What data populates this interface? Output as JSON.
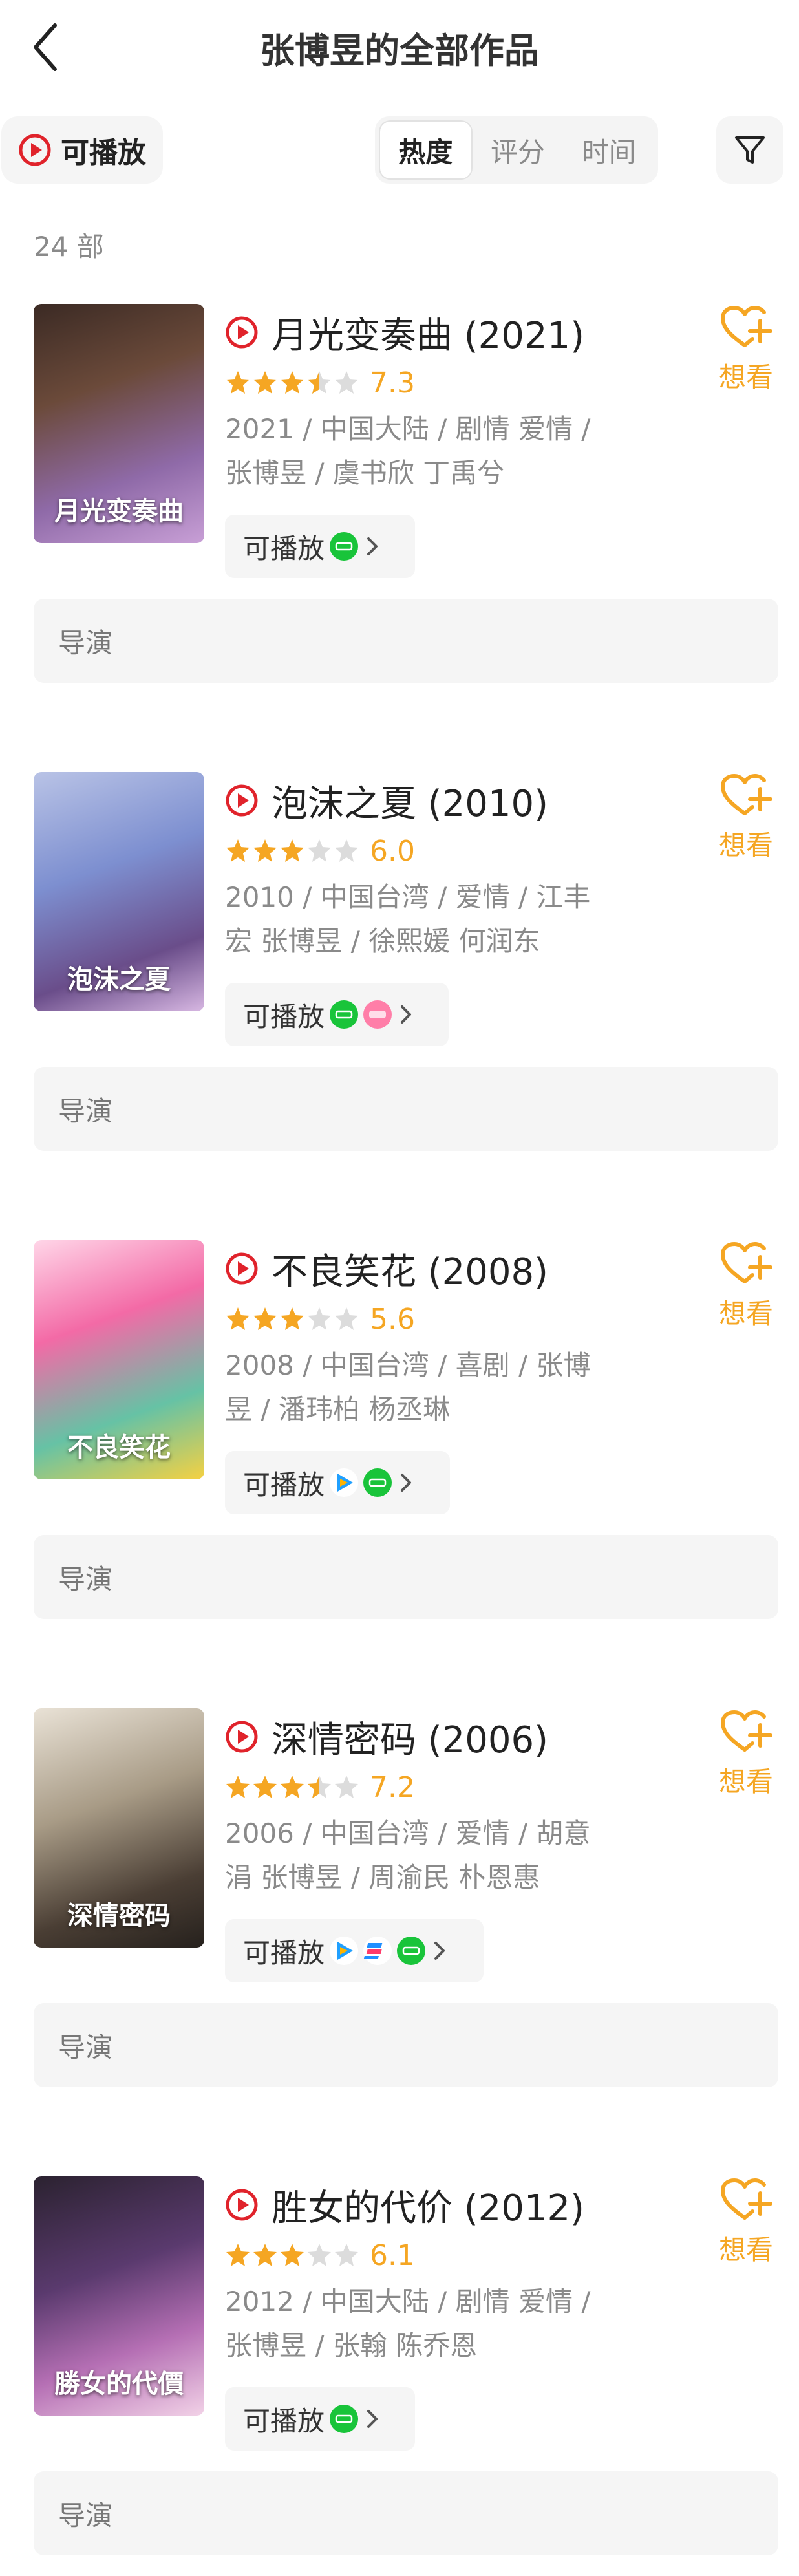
{
  "header": {
    "title": "张博昱的全部作品"
  },
  "filters": {
    "playable_label": "可播放",
    "sort_tabs": [
      "热度",
      "评分",
      "时间"
    ],
    "active_sort": "热度"
  },
  "count_text": "24 部",
  "colors": {
    "accent": "#f5a623",
    "play_red": "#e0232b",
    "iqiyi_green": "#19c43a"
  },
  "movies": [
    {
      "title": "月光变奏曲 (2021)",
      "stars": 3.5,
      "score": "7.3",
      "meta_line1": "2021 / 中国大陆 / 剧情 爱情 /",
      "meta_line2": "张博昱 / 虞书欣 丁禹兮",
      "playable": "可播放",
      "sources": [
        "iqiyi"
      ],
      "want_label": "想看",
      "director_label": "导演",
      "poster_text": "月光变奏曲"
    },
    {
      "title": "泡沫之夏 (2010)",
      "stars": 3,
      "score": "6.0",
      "meta_line1": "2010 / 中国台湾 / 爱情 / 江丰",
      "meta_line2": "宏 张博昱 / 徐熙媛 何润东",
      "playable": "可播放",
      "sources": [
        "iqiyi",
        "mgtv"
      ],
      "want_label": "想看",
      "director_label": "导演",
      "poster_text": "泡沫之夏"
    },
    {
      "title": "不良笑花 (2008)",
      "stars": 3,
      "score": "5.6",
      "meta_line1": "2008 / 中国台湾 / 喜剧 / 张博",
      "meta_line2": "昱 / 潘玮柏 杨丞琳",
      "playable": "可播放",
      "sources": [
        "tencent",
        "iqiyi"
      ],
      "want_label": "想看",
      "director_label": "导演",
      "poster_text": "不良笑花"
    },
    {
      "title": "深情密码 (2006)",
      "stars": 3.5,
      "score": "7.2",
      "meta_line1": "2006 / 中国台湾 / 爱情 / 胡意",
      "meta_line2": "涓 张博昱 / 周渝民 朴恩惠",
      "playable": "可播放",
      "sources": [
        "tencent",
        "bili",
        "iqiyi"
      ],
      "want_label": "想看",
      "director_label": "导演",
      "poster_text": "深情密码"
    },
    {
      "title": "胜女的代价 (2012)",
      "stars": 3,
      "score": "6.1",
      "meta_line1": "2012 / 中国大陆 / 剧情 爱情 /",
      "meta_line2": "张博昱 / 张翰 陈乔恩",
      "playable": "可播放",
      "sources": [
        "iqiyi"
      ],
      "want_label": "想看",
      "director_label": "导演",
      "poster_text": "勝女的代價"
    }
  ]
}
